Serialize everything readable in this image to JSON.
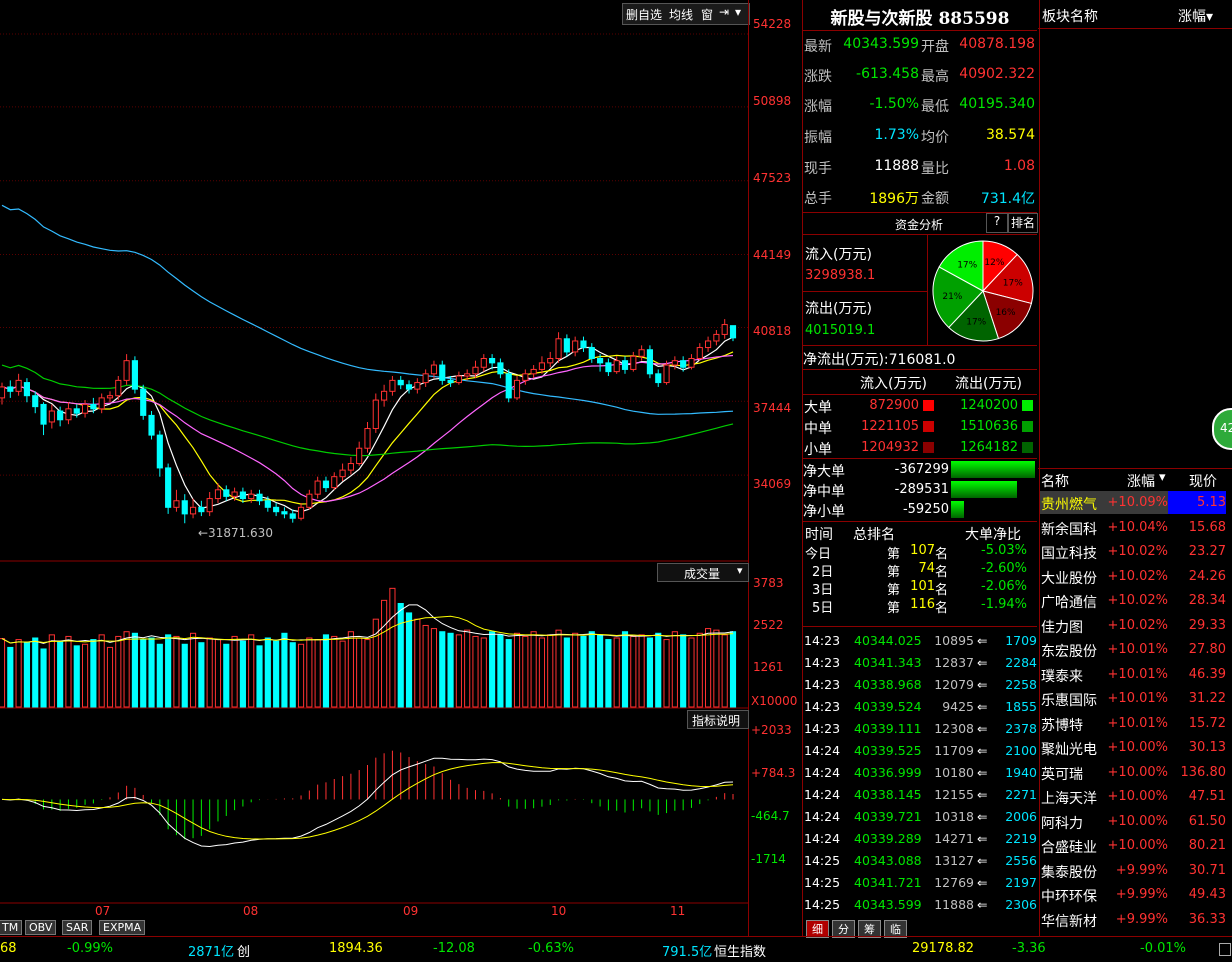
{
  "toolbar": {
    "btn1": "删自选",
    "btn2": "均线",
    "btn3": "窗",
    "btn4": "⇥",
    "btn5": "▾"
  },
  "price_axis": [
    "54228",
    "50898",
    "47523",
    "44149",
    "40818",
    "37444",
    "34069"
  ],
  "low_annotation": "←31871.630",
  "vol_panel": {
    "dropdown": "成交量",
    "ticks": [
      "3783",
      "2522",
      "1261"
    ],
    "unit": "X10000"
  },
  "indicator_panel": {
    "button": "指标说明",
    "ticks": [
      "+2033",
      "+784.3",
      "-464.7",
      "-1714"
    ]
  },
  "x_axis": [
    "07",
    "08",
    "09",
    "10",
    "11"
  ],
  "bottom_tabs": [
    "TM",
    "OBV",
    "SAR",
    "EXPMA"
  ],
  "stock": {
    "name": "新股与次新股",
    "code": "885598"
  },
  "quote": {
    "rows": [
      {
        "l1": "最新",
        "v1": "40343.599",
        "l2": "开盘",
        "v2": "40878.198"
      },
      {
        "l1": "涨跌",
        "v1": "-613.458",
        "l2": "最高",
        "v2": "40902.322"
      },
      {
        "l1": "涨幅",
        "v1": "-1.50%",
        "l2": "最低",
        "v2": "40195.340"
      },
      {
        "l1": "振幅",
        "v1": "1.73%",
        "l2": "均价",
        "v2": "38.574"
      },
      {
        "l1": "现手",
        "v1": "11888",
        "l2": "量比",
        "v2": "1.08"
      },
      {
        "l1": "总手",
        "v1": "1896万",
        "l2": "金额",
        "v2": "731.4亿"
      }
    ]
  },
  "fund": {
    "title": "资金分析",
    "q": "?",
    "rank": "排名",
    "inflow_label": "流入(万元)",
    "inflow_value": "3298938.1",
    "outflow_label": "流出(万元)",
    "outflow_value": "4015019.1",
    "pie": [
      {
        "label": "12%",
        "pct": 12,
        "color": "#ff0000"
      },
      {
        "label": "17%",
        "pct": 17,
        "color": "#cc0000"
      },
      {
        "label": "16%",
        "pct": 16,
        "color": "#8b0000"
      },
      {
        "label": "17%",
        "pct": 17,
        "color": "#006400"
      },
      {
        "label": "21%",
        "pct": 21,
        "color": "#00a000"
      },
      {
        "label": "17%",
        "pct": 17,
        "color": "#00ee00"
      }
    ],
    "net_label": "净流出(万元):",
    "net_value": "716081.0"
  },
  "orders": {
    "h_in": "流入(万元)",
    "h_out": "流出(万元)",
    "rows": [
      {
        "label": "大单",
        "in": "872900",
        "out": "1240200",
        "cin": "#ff0000",
        "cout": "#00ee00"
      },
      {
        "label": "中单",
        "in": "1221105",
        "out": "1510636",
        "cin": "#cc0000",
        "cout": "#00a000"
      },
      {
        "label": "小单",
        "in": "1204932",
        "out": "1264182",
        "cin": "#8b0000",
        "cout": "#006400"
      }
    ],
    "net": [
      {
        "label": "净大单",
        "value": "-367299",
        "frac": 1.0
      },
      {
        "label": "净中单",
        "value": "-289531",
        "frac": 0.79
      },
      {
        "label": "净小单",
        "value": "-59250",
        "frac": 0.16
      }
    ]
  },
  "ranking": {
    "h1": "时间",
    "h2": "总排名",
    "h3": "大单净比",
    "rows": [
      {
        "t": "今日",
        "pre": "第",
        "n": "107",
        "suf": "名",
        "r": "-5.03%"
      },
      {
        "t": "2日",
        "pre": "第",
        "n": "74",
        "suf": "名",
        "r": "-2.60%"
      },
      {
        "t": "3日",
        "pre": "第",
        "n": "101",
        "suf": "名",
        "r": "-2.06%"
      },
      {
        "t": "5日",
        "pre": "第",
        "n": "116",
        "suf": "名",
        "r": "-1.94%"
      }
    ]
  },
  "ticks": [
    {
      "time": "14:23",
      "price": "40344.025",
      "vol": "10895",
      "arrow": "⇐",
      "n": "1709"
    },
    {
      "time": "14:23",
      "price": "40341.343",
      "vol": "12837",
      "arrow": "⇐",
      "n": "2284"
    },
    {
      "time": "14:23",
      "price": "40338.968",
      "vol": "12079",
      "arrow": "⇐",
      "n": "2258"
    },
    {
      "time": "14:23",
      "price": "40339.524",
      "vol": "9425",
      "arrow": "⇐",
      "n": "1855"
    },
    {
      "time": "14:23",
      "price": "40339.111",
      "vol": "12308",
      "arrow": "⇐",
      "n": "2378"
    },
    {
      "time": "14:24",
      "price": "40339.525",
      "vol": "11709",
      "arrow": "⇐",
      "n": "2100"
    },
    {
      "time": "14:24",
      "price": "40336.999",
      "vol": "10180",
      "arrow": "⇐",
      "n": "1940"
    },
    {
      "time": "14:24",
      "price": "40338.145",
      "vol": "12155",
      "arrow": "⇐",
      "n": "2271"
    },
    {
      "time": "14:24",
      "price": "40339.721",
      "vol": "10318",
      "arrow": "⇐",
      "n": "2006"
    },
    {
      "time": "14:24",
      "price": "40339.289",
      "vol": "14271",
      "arrow": "⇐",
      "n": "2219"
    },
    {
      "time": "14:25",
      "price": "40343.088",
      "vol": "13127",
      "arrow": "⇐",
      "n": "2556"
    },
    {
      "time": "14:25",
      "price": "40341.721",
      "vol": "12769",
      "arrow": "⇐",
      "n": "2197"
    },
    {
      "time": "14:25",
      "price": "40343.599",
      "vol": "11888",
      "arrow": "⇐",
      "n": "2306"
    }
  ],
  "detail_tabs": [
    "细",
    "分",
    "筹",
    "临"
  ],
  "sector": {
    "h1": "板块名称",
    "h2": "涨幅▾"
  },
  "badge": "42",
  "stocks": {
    "h_name": "名称",
    "h_chg": "涨幅",
    "h_sort": "▾",
    "h_price": "现价",
    "rows": [
      {
        "name": "贵州燃气",
        "chg": "+10.09%",
        "price": "5.13"
      },
      {
        "name": "新余国科",
        "chg": "+10.04%",
        "price": "15.68"
      },
      {
        "name": "国立科技",
        "chg": "+10.02%",
        "price": "23.27"
      },
      {
        "name": "大业股份",
        "chg": "+10.02%",
        "price": "24.26"
      },
      {
        "name": "广哈通信",
        "chg": "+10.02%",
        "price": "28.34"
      },
      {
        "name": "佳力图",
        "chg": "+10.02%",
        "price": "29.33"
      },
      {
        "name": "东宏股份",
        "chg": "+10.01%",
        "price": "27.80"
      },
      {
        "name": "璞泰来",
        "chg": "+10.01%",
        "price": "46.39"
      },
      {
        "name": "乐惠国际",
        "chg": "+10.01%",
        "price": "31.22"
      },
      {
        "name": "苏博特",
        "chg": "+10.01%",
        "price": "15.72"
      },
      {
        "name": "聚灿光电",
        "chg": "+10.00%",
        "price": "30.13"
      },
      {
        "name": "英可瑞",
        "chg": "+10.00%",
        "price": "136.80"
      },
      {
        "name": "上海天洋",
        "chg": "+10.00%",
        "price": "47.51"
      },
      {
        "name": "阿科力",
        "chg": "+10.00%",
        "price": "61.50"
      },
      {
        "name": "合盛硅业",
        "chg": "+10.00%",
        "price": "80.21"
      },
      {
        "name": "集泰股份",
        "chg": "+9.99%",
        "price": "30.71"
      },
      {
        "name": "中环环保",
        "chg": "+9.99%",
        "price": "49.43"
      },
      {
        "name": "华信新材",
        "chg": "+9.99%",
        "price": "36.33"
      }
    ]
  },
  "statusbar": {
    "s1": "68",
    "s2": "-0.99%",
    "s3": "2871亿",
    "s4": "创",
    "s5": "1894.36",
    "s6": "-12.08",
    "s7": "-0.63%",
    "s8": "791.5亿",
    "s9": "恒生指数",
    "s10": "29178.82",
    "s11": "-3.36",
    "s12": "-0.01%"
  },
  "chart_data": {
    "type": "candlestick",
    "x_tick_labels": [
      "07",
      "08",
      "09",
      "10",
      "11"
    ],
    "y_ticks": [
      54228,
      50898,
      47523,
      44149,
      40818,
      37444,
      34069
    ],
    "ylim": [
      30500,
      54500
    ],
    "low_marker": 31871.63,
    "candles": [
      {
        "o": 37600,
        "c": 38100,
        "h": 38300,
        "l": 37300
      },
      {
        "o": 38100,
        "c": 37900,
        "h": 38400,
        "l": 37600
      },
      {
        "o": 37900,
        "c": 38400,
        "h": 38700,
        "l": 37700
      },
      {
        "o": 38300,
        "c": 37700,
        "h": 38500,
        "l": 37400
      },
      {
        "o": 37700,
        "c": 37200,
        "h": 37900,
        "l": 36900
      },
      {
        "o": 37300,
        "c": 36400,
        "h": 37400,
        "l": 35900
      },
      {
        "o": 36500,
        "c": 37000,
        "h": 37300,
        "l": 36200
      },
      {
        "o": 37000,
        "c": 36600,
        "h": 37200,
        "l": 36300
      },
      {
        "o": 36600,
        "c": 37100,
        "h": 37400,
        "l": 36400
      },
      {
        "o": 37100,
        "c": 36900,
        "h": 37300,
        "l": 36700
      },
      {
        "o": 36900,
        "c": 37300,
        "h": 37500,
        "l": 36700
      },
      {
        "o": 37300,
        "c": 37100,
        "h": 37600,
        "l": 36900
      },
      {
        "o": 37100,
        "c": 37600,
        "h": 37800,
        "l": 36900
      },
      {
        "o": 37600,
        "c": 37700,
        "h": 37900,
        "l": 37400
      },
      {
        "o": 37700,
        "c": 38400,
        "h": 38600,
        "l": 37500
      },
      {
        "o": 38400,
        "c": 39300,
        "h": 39600,
        "l": 38200
      },
      {
        "o": 39300,
        "c": 38000,
        "h": 39500,
        "l": 37800
      },
      {
        "o": 38000,
        "c": 36800,
        "h": 38200,
        "l": 36600
      },
      {
        "o": 36800,
        "c": 35900,
        "h": 37000,
        "l": 35700
      },
      {
        "o": 35900,
        "c": 34400,
        "h": 36100,
        "l": 34000
      },
      {
        "o": 34400,
        "c": 32600,
        "h": 34600,
        "l": 32300
      },
      {
        "o": 32600,
        "c": 32900,
        "h": 33400,
        "l": 32400
      },
      {
        "o": 32900,
        "c": 32300,
        "h": 33200,
        "l": 31872
      },
      {
        "o": 32300,
        "c": 32600,
        "h": 33000,
        "l": 32100
      },
      {
        "o": 32600,
        "c": 32400,
        "h": 32900,
        "l": 32200
      },
      {
        "o": 32400,
        "c": 33000,
        "h": 33300,
        "l": 32200
      },
      {
        "o": 33000,
        "c": 33400,
        "h": 33700,
        "l": 32800
      },
      {
        "o": 33400,
        "c": 33100,
        "h": 33600,
        "l": 32900
      },
      {
        "o": 33100,
        "c": 33300,
        "h": 33500,
        "l": 32900
      },
      {
        "o": 33300,
        "c": 33000,
        "h": 33500,
        "l": 32800
      },
      {
        "o": 33000,
        "c": 33200,
        "h": 33400,
        "l": 32800
      },
      {
        "o": 33200,
        "c": 32900,
        "h": 33400,
        "l": 32700
      },
      {
        "o": 32900,
        "c": 32600,
        "h": 33100,
        "l": 32400
      },
      {
        "o": 32600,
        "c": 32400,
        "h": 32800,
        "l": 32200
      },
      {
        "o": 32400,
        "c": 32300,
        "h": 32600,
        "l": 32100
      },
      {
        "o": 32300,
        "c": 32100,
        "h": 32500,
        "l": 31900
      },
      {
        "o": 32100,
        "c": 32600,
        "h": 32800,
        "l": 32000
      },
      {
        "o": 32600,
        "c": 33200,
        "h": 33400,
        "l": 32500
      },
      {
        "o": 33200,
        "c": 33800,
        "h": 34000,
        "l": 33000
      },
      {
        "o": 33800,
        "c": 33500,
        "h": 34000,
        "l": 33300
      },
      {
        "o": 33500,
        "c": 34000,
        "h": 34200,
        "l": 33400
      },
      {
        "o": 34000,
        "c": 34300,
        "h": 34600,
        "l": 33800
      },
      {
        "o": 34300,
        "c": 34600,
        "h": 34900,
        "l": 34100
      },
      {
        "o": 34600,
        "c": 35300,
        "h": 35600,
        "l": 34500
      },
      {
        "o": 35300,
        "c": 36200,
        "h": 36500,
        "l": 35100
      },
      {
        "o": 36200,
        "c": 37500,
        "h": 37800,
        "l": 36000
      },
      {
        "o": 37500,
        "c": 37900,
        "h": 38200,
        "l": 37200
      },
      {
        "o": 37900,
        "c": 38400,
        "h": 38600,
        "l": 37700
      },
      {
        "o": 38400,
        "c": 38200,
        "h": 38600,
        "l": 38000
      },
      {
        "o": 38200,
        "c": 38000,
        "h": 38400,
        "l": 37800
      },
      {
        "o": 38000,
        "c": 38300,
        "h": 38500,
        "l": 37800
      },
      {
        "o": 38300,
        "c": 38700,
        "h": 38900,
        "l": 38100
      },
      {
        "o": 38700,
        "c": 39100,
        "h": 39300,
        "l": 38500
      },
      {
        "o": 39100,
        "c": 38400,
        "h": 39300,
        "l": 38200
      },
      {
        "o": 38400,
        "c": 38300,
        "h": 38600,
        "l": 38100
      },
      {
        "o": 38300,
        "c": 38600,
        "h": 38800,
        "l": 38200
      },
      {
        "o": 38600,
        "c": 38700,
        "h": 38900,
        "l": 38400
      },
      {
        "o": 38700,
        "c": 39000,
        "h": 39300,
        "l": 38500
      },
      {
        "o": 39000,
        "c": 39400,
        "h": 39600,
        "l": 38800
      },
      {
        "o": 39400,
        "c": 39200,
        "h": 39600,
        "l": 38900
      },
      {
        "o": 39200,
        "c": 38700,
        "h": 39400,
        "l": 38500
      },
      {
        "o": 38700,
        "c": 37600,
        "h": 38900,
        "l": 37400
      },
      {
        "o": 37600,
        "c": 38400,
        "h": 38600,
        "l": 37500
      },
      {
        "o": 38400,
        "c": 38700,
        "h": 38900,
        "l": 38200
      },
      {
        "o": 38700,
        "c": 38900,
        "h": 39100,
        "l": 38500
      },
      {
        "o": 38900,
        "c": 39200,
        "h": 39500,
        "l": 38700
      },
      {
        "o": 39200,
        "c": 39400,
        "h": 39700,
        "l": 39000
      },
      {
        "o": 39400,
        "c": 40300,
        "h": 40600,
        "l": 39200
      },
      {
        "o": 40300,
        "c": 39700,
        "h": 40500,
        "l": 39500
      },
      {
        "o": 39700,
        "c": 40200,
        "h": 40400,
        "l": 39500
      },
      {
        "o": 40200,
        "c": 39900,
        "h": 40400,
        "l": 39700
      },
      {
        "o": 39900,
        "c": 39400,
        "h": 40100,
        "l": 39200
      },
      {
        "o": 39400,
        "c": 39200,
        "h": 39600,
        "l": 38800
      },
      {
        "o": 39200,
        "c": 38800,
        "h": 39400,
        "l": 38600
      },
      {
        "o": 38800,
        "c": 39300,
        "h": 39500,
        "l": 38700
      },
      {
        "o": 39300,
        "c": 38900,
        "h": 39500,
        "l": 38700
      },
      {
        "o": 38900,
        "c": 39500,
        "h": 39700,
        "l": 38800
      },
      {
        "o": 39500,
        "c": 39800,
        "h": 40000,
        "l": 39300
      },
      {
        "o": 39800,
        "c": 38700,
        "h": 40000,
        "l": 38500
      },
      {
        "o": 38700,
        "c": 38300,
        "h": 38900,
        "l": 38100
      },
      {
        "o": 38300,
        "c": 39100,
        "h": 39300,
        "l": 38200
      },
      {
        "o": 39100,
        "c": 39300,
        "h": 39500,
        "l": 38900
      },
      {
        "o": 39300,
        "c": 39000,
        "h": 39500,
        "l": 38800
      },
      {
        "o": 39000,
        "c": 39400,
        "h": 39600,
        "l": 38900
      },
      {
        "o": 39400,
        "c": 39900,
        "h": 40100,
        "l": 39300
      },
      {
        "o": 39900,
        "c": 40200,
        "h": 40400,
        "l": 39700
      },
      {
        "o": 40200,
        "c": 40500,
        "h": 40700,
        "l": 40000
      },
      {
        "o": 40500,
        "c": 40950,
        "h": 41200,
        "l": 40300
      },
      {
        "o": 40900,
        "c": 40344,
        "h": 40902,
        "l": 40195
      }
    ],
    "volume": [
      2180,
      1900,
      2150,
      2050,
      2200,
      1850,
      2300,
      2100,
      2250,
      1950,
      2000,
      2150,
      2300,
      1900,
      2250,
      2400,
      2350,
      2150,
      2200,
      2000,
      2300,
      2250,
      2000,
      2350,
      2050,
      2200,
      2150,
      2000,
      2250,
      2100,
      2300,
      1950,
      2200,
      2100,
      2350,
      2050,
      2000,
      2200,
      2150,
      2300,
      2250,
      2100,
      2400,
      2200,
      2150,
      2800,
      3400,
      3783,
      3300,
      3000,
      2800,
      2600,
      2500,
      2400,
      2350,
      2300,
      2450,
      2250,
      2200,
      2400,
      2300,
      2150,
      2350,
      2250,
      2400,
      2200,
      2300,
      2450,
      2200,
      2350,
      2250,
      2400,
      2300,
      2150,
      2200,
      2400,
      2250,
      2300,
      2200,
      2350,
      2150,
      2400,
      2300,
      2200,
      2350,
      2500,
      2450,
      2300,
      2400,
      2350
    ],
    "volume_ylim": [
      0,
      4000
    ],
    "indicator_ticks": [
      2033,
      784.3,
      -464.7,
      -1714
    ]
  }
}
